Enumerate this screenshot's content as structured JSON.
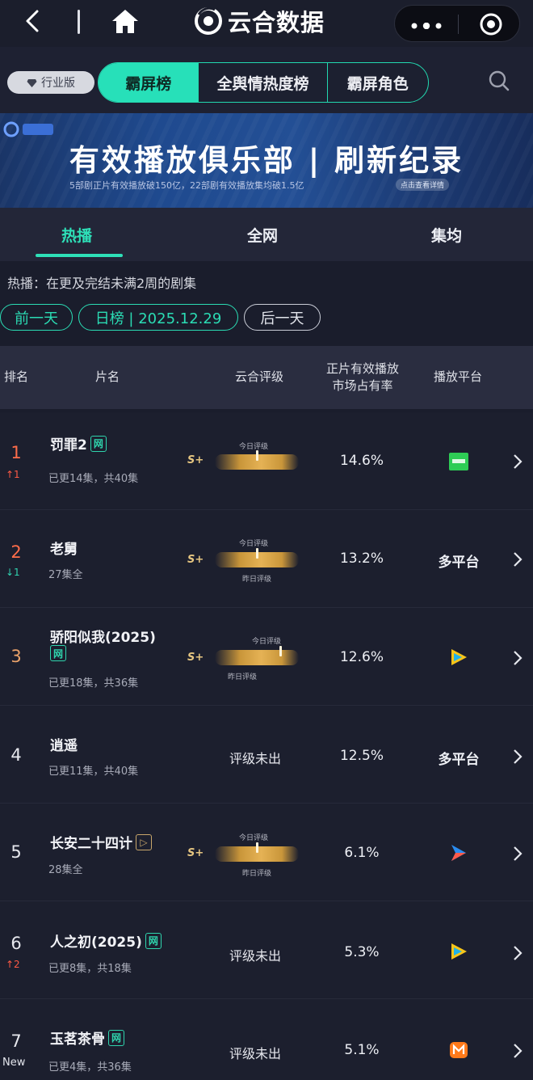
{
  "nav": {
    "brand": "云合数据"
  },
  "filters": {
    "edition": "行业版",
    "tabs": [
      "霸屏榜",
      "全舆情热度榜",
      "霸屏角色"
    ]
  },
  "banner": {
    "title": "有效播放俱乐部 | 刷新纪录",
    "subtitle": "5部剧正片有效播放破150亿，22部剧有效播放集均破1.5亿",
    "chip": "点击查看详情"
  },
  "tabs": [
    "热播",
    "全网",
    "集均"
  ],
  "info": "热播：在更及完结未满2周的剧集",
  "date_nav": {
    "prev": "前一天",
    "current": "日榜 | 2025.12.29",
    "next": "后一天"
  },
  "table": {
    "headers": {
      "rank": "排名",
      "title": "片名",
      "rating": "云合评级",
      "share_line1": "正片有效播放",
      "share_line2": "市场占有率",
      "platform": "播放平台"
    },
    "gauge_labels": {
      "today": "今日评级",
      "yesterday": "昨日评级",
      "grade": "S+"
    },
    "rows": [
      {
        "rank": "1",
        "change": "↑1",
        "title": "罚罪2",
        "tag": "网",
        "episodes": "已更14集，共40集",
        "rating": "S+",
        "share": "14.6%",
        "platform": "",
        "platform_icon": "iqiyi-green-icon"
      },
      {
        "rank": "2",
        "change": "↓1",
        "title": "老舅",
        "tag": "",
        "episodes": "27集全",
        "rating": "S+",
        "share": "13.2%",
        "platform": "多平台",
        "platform_icon": ""
      },
      {
        "rank": "3",
        "change": "",
        "title": "骄阳似我(2025)",
        "tag": "网",
        "episodes": "已更18集，共36集",
        "rating": "S+",
        "share": "12.6%",
        "platform": "",
        "platform_icon": "tencent-video-icon"
      },
      {
        "rank": "4",
        "change": "",
        "title": "逍遥",
        "tag": "",
        "episodes": "已更11集，共40集",
        "rating": "评级未出",
        "share": "12.5%",
        "platform": "多平台",
        "platform_icon": ""
      },
      {
        "rank": "5",
        "change": "",
        "title": "长安二十四计",
        "tag": "▷",
        "episodes": "28集全",
        "rating": "S+",
        "share": "6.1%",
        "platform": "",
        "platform_icon": "youku-icon"
      },
      {
        "rank": "6",
        "change": "↑2",
        "title": "人之初(2025)",
        "tag": "网",
        "episodes": "已更8集，共18集",
        "rating": "评级未出",
        "share": "5.3%",
        "platform": "",
        "platform_icon": "tencent-video-icon"
      },
      {
        "rank": "7",
        "change": "New",
        "title": "玉茗茶骨",
        "tag": "网",
        "episodes": "已更4集，共36集",
        "rating": "评级未出",
        "share": "5.1%",
        "platform": "",
        "platform_icon": "mgtv-icon"
      }
    ]
  },
  "colors": {
    "accent": "#2ee0b8",
    "background": "#1c1f2e",
    "rank_top": "#ff6d4a",
    "up": "#ff5a45",
    "down": "#30d3b0",
    "gauge": "#e5b255"
  }
}
